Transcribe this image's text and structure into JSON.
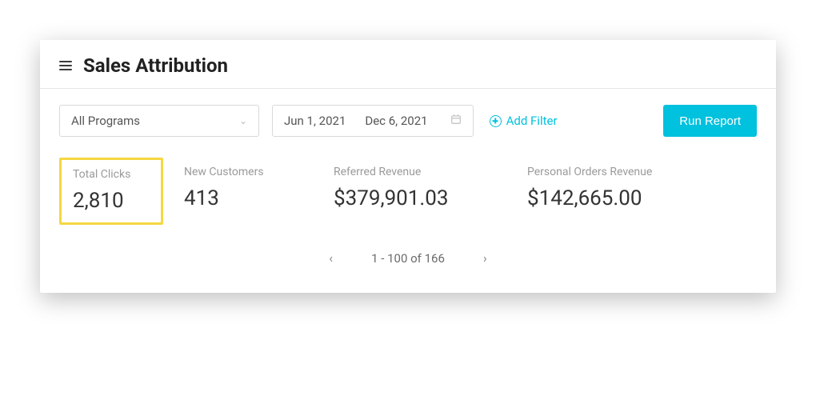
{
  "header": {
    "title": "Sales Attribution"
  },
  "filters": {
    "program_select": "All Programs",
    "date_start": "Jun 1, 2021",
    "date_end": "Dec 6, 2021",
    "add_filter_label": "Add Filter",
    "run_report_label": "Run Report"
  },
  "metrics": [
    {
      "label": "Total Clicks",
      "value": "2,810",
      "highlight": true
    },
    {
      "label": "New Customers",
      "value": "413",
      "highlight": false
    },
    {
      "label": "Referred Revenue",
      "value": "$379,901.03",
      "highlight": false
    },
    {
      "label": "Personal Orders Revenue",
      "value": "$142,665.00",
      "highlight": false
    }
  ],
  "pagination": {
    "range_text": "1 - 100 of 166"
  }
}
